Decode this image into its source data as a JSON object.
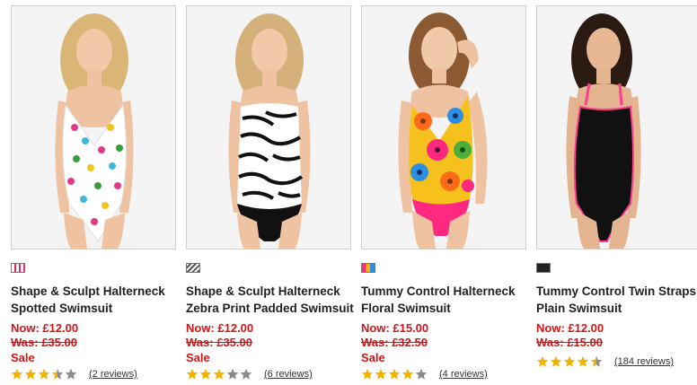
{
  "products": [
    {
      "title_line1": "Shape & Sculpt Halterneck",
      "title_line2": "Spotted Swimsuit",
      "now": "Now: £12.00",
      "was": "Was: £35.00",
      "sale": "Sale",
      "rating": 3.5,
      "reviews": "(2 reviews)",
      "swatch_color": "#d22c6b",
      "swatch_icon": "spotted-pattern",
      "suit_colors": [
        "#ffffff",
        "#e23a86",
        "#3fb8d8",
        "#f2c21a",
        "#3a9b3a"
      ]
    },
    {
      "title_line1": "Shape & Sculpt Halterneck",
      "title_line2": "Zebra Print Padded Swimsuit",
      "now": "Now: £12.00",
      "was": "Was: £35.00",
      "sale": "Sale",
      "rating": 3,
      "reviews": "(6 reviews)",
      "swatch_color": "#555555",
      "swatch_icon": "zebra-pattern",
      "suit_colors": [
        "#ffffff",
        "#111111"
      ]
    },
    {
      "title_line1": "Tummy Control Halterneck",
      "title_line2": "Floral Swimsuit",
      "now": "Now: £15.00",
      "was": "Was: £32.50",
      "sale": "Sale",
      "rating": 4,
      "reviews": "(4 reviews)",
      "swatch_color": "#f5b400",
      "swatch_icon": "floral-pattern",
      "suit_colors": [
        "#ff2a7f",
        "#f7c11d",
        "#2e8fe0",
        "#ff6a1a",
        "#4cae3a"
      ]
    },
    {
      "title_line1": "Tummy Control Twin Straps",
      "title_line2": "Plain Swimsuit",
      "now": "Now: £12.00",
      "was": "Was: £15.00",
      "sale": "",
      "rating": 4.5,
      "reviews": "(184 reviews)",
      "swatch_color": "#222222",
      "swatch_icon": "plain-black",
      "suit_colors": [
        "#111111",
        "#ff3f8e"
      ]
    }
  ],
  "colors": {
    "price_red": "#d21414",
    "star_gold": "#f0b400",
    "star_grey": "#8a8a8a"
  }
}
